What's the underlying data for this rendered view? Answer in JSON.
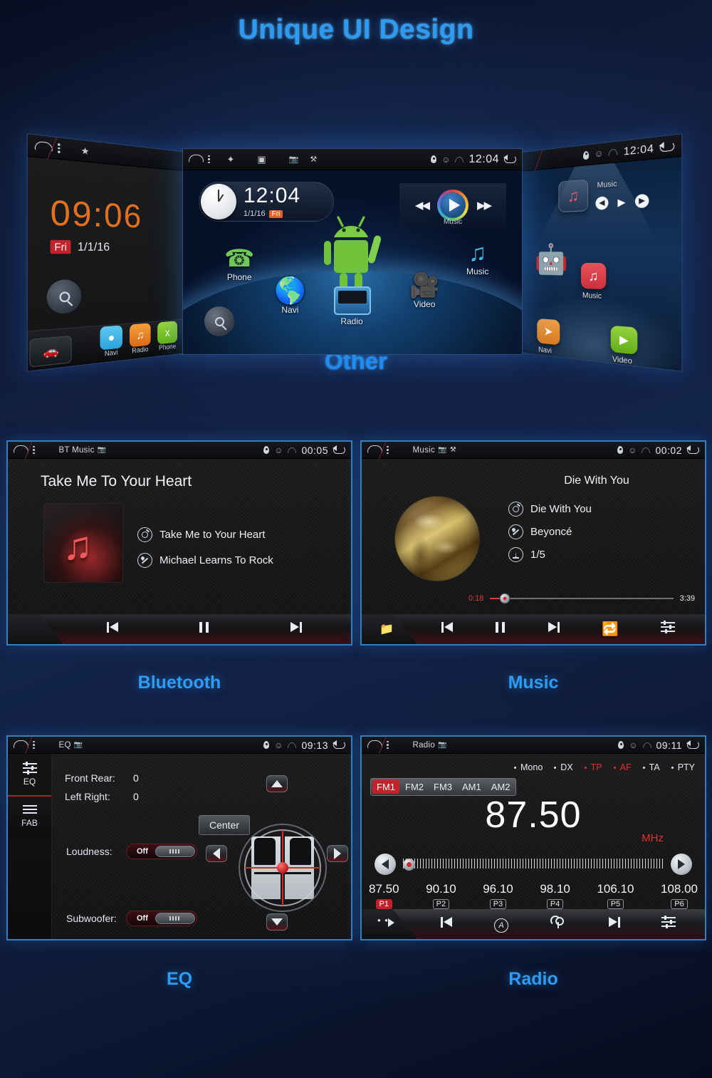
{
  "page": {
    "hero_title": "Unique UI Design",
    "section_other": "Other"
  },
  "hero": {
    "center": {
      "status": {
        "title": "",
        "clock": "12:04"
      },
      "clock_widget": {
        "time": "12:04",
        "date": "1/1/16",
        "day": "Fri"
      },
      "music_widget": {
        "label": "Music"
      },
      "apps": [
        {
          "label": "Phone"
        },
        {
          "label": "Navi"
        },
        {
          "label": "Radio"
        },
        {
          "label": "Video"
        },
        {
          "label": "Music"
        }
      ]
    },
    "left": {
      "status": {
        "clock": ""
      },
      "clock": "09:06",
      "day": "Fri",
      "date": "1/1/16",
      "dock": [
        {
          "label": "Navi"
        },
        {
          "label": "Radio"
        },
        {
          "label": "Phone"
        }
      ]
    },
    "right": {
      "status": {
        "clock": "12:04"
      },
      "widget_label": "Music",
      "tiles": [
        {
          "label": "Music"
        },
        {
          "label": "Navi"
        },
        {
          "label": "Video"
        }
      ]
    }
  },
  "bluetooth": {
    "caption": "Bluetooth",
    "status": {
      "title": "BT Music",
      "clock": "00:05"
    },
    "track_heading": "Take Me To Your Heart",
    "meta": [
      {
        "icon": "cd-icon",
        "text": "Take Me to Your Heart"
      },
      {
        "icon": "artist-icon",
        "text": "Michael Learns To Rock"
      }
    ],
    "transport": [
      "prev",
      "pause",
      "next"
    ]
  },
  "music": {
    "caption": "Music",
    "status": {
      "title": "Music",
      "clock": "00:02"
    },
    "track_heading": "Die With You",
    "meta": [
      {
        "icon": "cd-icon",
        "text": "Die With You"
      },
      {
        "icon": "artist-icon",
        "text": "Beyoncé"
      },
      {
        "icon": "list-icon",
        "text": "1/5"
      }
    ],
    "progress": {
      "current": "0:18",
      "total": "3:39",
      "percent": 8
    },
    "transport": [
      "folder",
      "prev",
      "pause",
      "next",
      "repeat",
      "eq"
    ]
  },
  "eq": {
    "caption": "EQ",
    "status": {
      "title": "EQ",
      "clock": "09:13"
    },
    "tabs": [
      {
        "label": "EQ",
        "active": false
      },
      {
        "label": "FAB",
        "active": true
      }
    ],
    "fields": [
      {
        "label": "Front Rear:",
        "value": "0"
      },
      {
        "label": "Left Right:",
        "value": "0"
      }
    ],
    "center_button": "Center",
    "toggles": [
      {
        "label": "Loudness:",
        "state": "Off"
      },
      {
        "label": "Subwoofer:",
        "state": "Off"
      }
    ]
  },
  "radio": {
    "caption": "Radio",
    "status": {
      "title": "Radio",
      "clock": "09:11"
    },
    "modes": [
      {
        "label": "Mono",
        "highlight": false
      },
      {
        "label": "DX",
        "highlight": false
      },
      {
        "label": "TP",
        "highlight": true
      },
      {
        "label": "AF",
        "highlight": true
      },
      {
        "label": "TA",
        "highlight": false
      },
      {
        "label": "PTY",
        "highlight": false
      }
    ],
    "bands": [
      {
        "label": "FM1",
        "active": true
      },
      {
        "label": "FM2",
        "active": false
      },
      {
        "label": "FM3",
        "active": false
      },
      {
        "label": "AM1",
        "active": false
      },
      {
        "label": "AM2",
        "active": false
      }
    ],
    "frequency": "87.50",
    "unit": "MHz",
    "presets": [
      {
        "freq": "87.50",
        "slot": "P1",
        "active": true
      },
      {
        "freq": "90.10",
        "slot": "P2",
        "active": false
      },
      {
        "freq": "96.10",
        "slot": "P3",
        "active": false
      },
      {
        "freq": "98.10",
        "slot": "P4",
        "active": false
      },
      {
        "freq": "106.10",
        "slot": "P5",
        "active": false
      },
      {
        "freq": "108.00",
        "slot": "P6",
        "active": false
      }
    ]
  },
  "colors": {
    "accent_blue": "#2e9bf0",
    "accent_red": "#c2222a",
    "orange_clock": "#e2701e"
  }
}
